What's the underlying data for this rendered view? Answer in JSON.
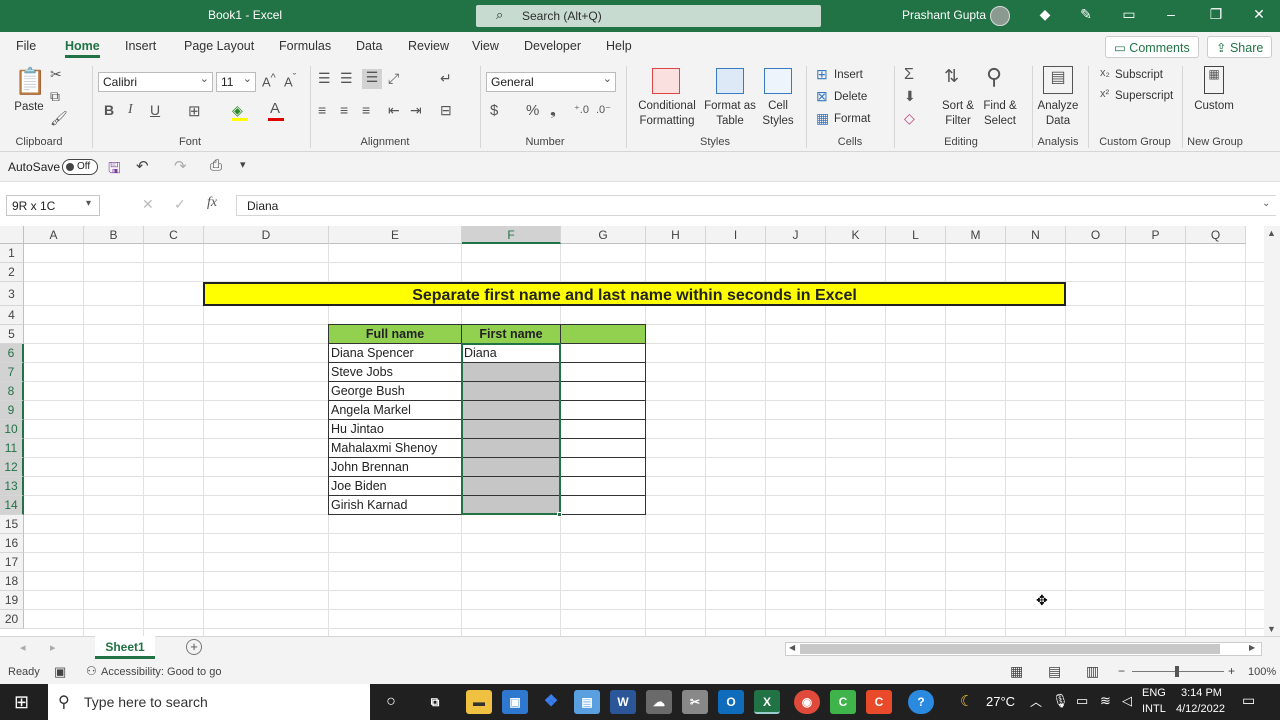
{
  "titlebar": {
    "doc_title": "Book1  -  Excel",
    "search_placeholder": "Search (Alt+Q)",
    "user": "Prashant Gupta"
  },
  "tabs": [
    "File",
    "Home",
    "Insert",
    "Page Layout",
    "Formulas",
    "Data",
    "Review",
    "View",
    "Developer",
    "Help"
  ],
  "active_tab": "Home",
  "comments_label": "Comments",
  "share_label": "Share",
  "ribbon": {
    "clipboard": {
      "paste": "Paste",
      "group": "Clipboard"
    },
    "font": {
      "name": "Calibri",
      "size": "11",
      "group": "Font",
      "bold": "B",
      "italic": "I",
      "underline": "U"
    },
    "alignment": {
      "group": "Alignment"
    },
    "number": {
      "format": "General",
      "group": "Number",
      "currency": "$",
      "percent": "%"
    },
    "styles": {
      "conditional": "Conditional",
      "conditional2": "Formatting",
      "format_as": "Format as",
      "format_as2": "Table",
      "cell": "Cell",
      "cell2": "Styles",
      "group": "Styles"
    },
    "cells": {
      "insert": "Insert",
      "delete": "Delete",
      "format": "Format",
      "group": "Cells"
    },
    "editing": {
      "sort": "Sort &",
      "sort2": "Filter",
      "find": "Find &",
      "find2": "Select",
      "group": "Editing"
    },
    "analysis": {
      "analyze": "Analyze",
      "analyze2": "Data",
      "group": "Analysis"
    },
    "custom_group": {
      "subscript": "Subscript",
      "superscript": "Superscript",
      "group": "Custom Group"
    },
    "new_group": {
      "custom": "Custom",
      "group": "New Group"
    }
  },
  "qat": {
    "autosave": "AutoSave",
    "autosave_state": "Off"
  },
  "formula_bar": {
    "name_box": "9R x 1C",
    "content": "Diana"
  },
  "columns": [
    "A",
    "B",
    "C",
    "D",
    "E",
    "F",
    "G",
    "H",
    "I",
    "J",
    "K",
    "L",
    "M",
    "N",
    "O",
    "P",
    "Q"
  ],
  "rows": [
    "1",
    "2",
    "3",
    "4",
    "5",
    "6",
    "7",
    "8",
    "9",
    "10",
    "11",
    "12",
    "13",
    "14",
    "15",
    "16",
    "17",
    "18",
    "19",
    "20"
  ],
  "sheet": {
    "banner": "Separate first name and last name within seconds in Excel",
    "headers": [
      "Full name",
      "First name",
      ""
    ],
    "full_names": [
      "Diana Spencer",
      "Steve Jobs",
      "George Bush",
      "Angela Markel",
      "Hu Jintao",
      "Mahalaxmi Shenoy",
      "John Brennan",
      "Joe Biden",
      "Girish Karnad"
    ],
    "first_names": [
      "Diana",
      "",
      "",
      "",
      "",
      "",
      "",
      "",
      ""
    ]
  },
  "sheet_tab": "Sheet1",
  "status": {
    "ready": "Ready",
    "accessibility": "Accessibility: Good to go",
    "zoom": "100%"
  },
  "taskbar": {
    "search_placeholder": "Type here to search",
    "temp": "27°C",
    "lang1": "ENG",
    "lang2": "INTL",
    "time": "3:14 PM",
    "date": "4/12/2022"
  },
  "colors": {
    "excel_green": "#217346",
    "banner_yellow": "#ffff00",
    "header_green": "#92d050",
    "selection_gray": "#c6c6c6"
  }
}
